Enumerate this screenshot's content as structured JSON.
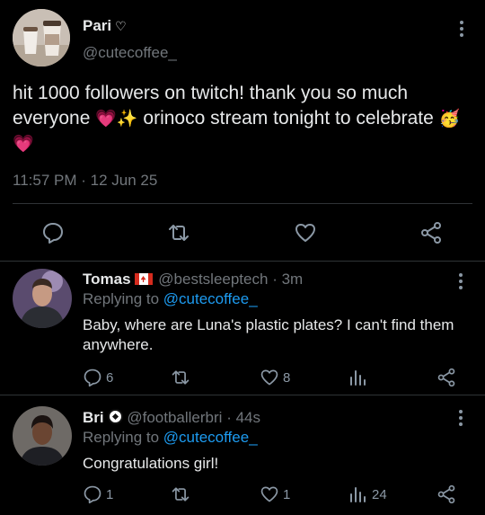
{
  "main_tweet": {
    "author": {
      "name": "Pari",
      "badge_icon": "heart-outline-icon",
      "badge_glyph": "♡",
      "handle": "@cutecoffee_"
    },
    "text_segments": [
      "hit 1000 followers on twitch! thank you so much everyone ",
      " orinoco stream tonight to celebrate "
    ],
    "emojis": {
      "heart": "💗",
      "sparkles": "✨",
      "party": "🥳"
    },
    "time": "11:57 PM",
    "separator": "·",
    "date": "12 Jun 25",
    "actions": [
      "reply-icon",
      "retweet-icon",
      "like-icon",
      "share-icon"
    ]
  },
  "replies": [
    {
      "name": "Tomas",
      "flag": "canada-flag-icon",
      "handle": "@bestsleeptech",
      "time_sep": "·",
      "time": "3m",
      "replying_prefix": "Replying to",
      "replying_to": "@cutecoffee_",
      "text": "Baby, where are Luna's plastic plates? I can't find them anywhere.",
      "counts": {
        "replies": "6",
        "retweets": "",
        "likes": "8",
        "views": ""
      }
    },
    {
      "name": "Bri",
      "badge": "soccer-ball-icon",
      "handle": "@footballerbri",
      "time_sep": "·",
      "time": "44s",
      "replying_prefix": "Replying to",
      "replying_to": "@cutecoffee_",
      "text": "Congratulations girl!",
      "counts": {
        "replies": "1",
        "retweets": "",
        "likes": "1",
        "views": "24"
      }
    }
  ],
  "colors": {
    "background": "#000000",
    "text": "#e7e9ea",
    "secondary": "#71767b",
    "link": "#1d9bf0",
    "divider": "#2f3336",
    "icon": "#8b98a5"
  }
}
